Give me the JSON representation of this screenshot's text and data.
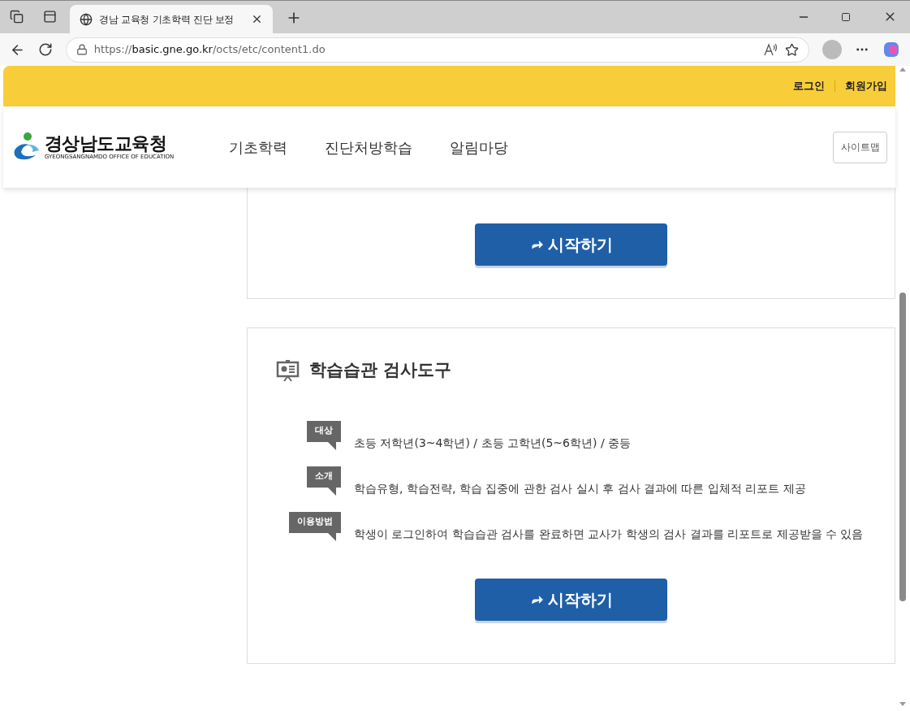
{
  "browser": {
    "tab_title": "경남 교육청 기초학력 진단 보정",
    "url": "https://**basic.gne.go.kr**/octs/etc/content1.do"
  },
  "top_links": [
    "로그인",
    "회원가입"
  ],
  "logo": {
    "name": "경상남도교육청",
    "subtitle": "GYEONGSANGNAMDO OFFICE OF EDUCATION"
  },
  "nav": [
    "기초학력",
    "진단처방학습",
    "알림마당"
  ],
  "sitemap": "사이트맵",
  "cards": [
    {
      "start_button": "시작하기"
    },
    {
      "title": "학습습관 검사도구",
      "rows": [
        {
          "label": "대상",
          "text": "초등 저학년(3~4학년) / 초등 고학년(5~6학년) / 중등"
        },
        {
          "label": "소개",
          "text": "학습유형, 학습전략, 학습 집중에 관한 검사 실시 후 검사 결과에 따른 입체적 리포트 제공"
        },
        {
          "label": "이용방법",
          "text": "학생이 로그인하여 학습습관 검사를 완료하면 교사가 학생의 검사 결과를 리포트로 제공받을 수 있음"
        }
      ],
      "start_button": "시작하기"
    }
  ]
}
